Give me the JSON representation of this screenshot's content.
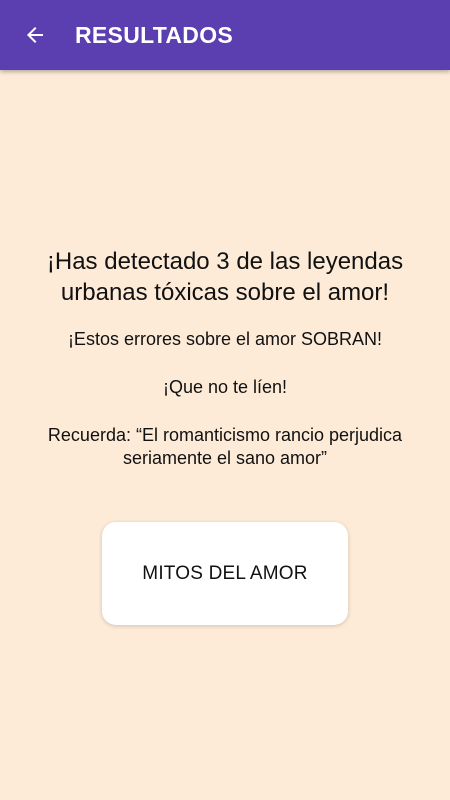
{
  "app_bar": {
    "title": "RESULTADOS",
    "back_icon": "arrow-left-icon",
    "background_color": "#5B3FB0"
  },
  "main": {
    "headline": "¡Has detectado 3 de las leyendas urbanas tóxicas sobre el amor!",
    "line_1": "¡Estos errores sobre el amor SOBRAN!",
    "line_2": "¡Que no te líen!",
    "quote": "Recuerda: “El romanticismo rancio perjudica seriamente el sano amor”",
    "button_label": "MITOS DEL AMOR"
  },
  "colors": {
    "background": "#FDEBD8",
    "button": "#FFFFFF"
  }
}
